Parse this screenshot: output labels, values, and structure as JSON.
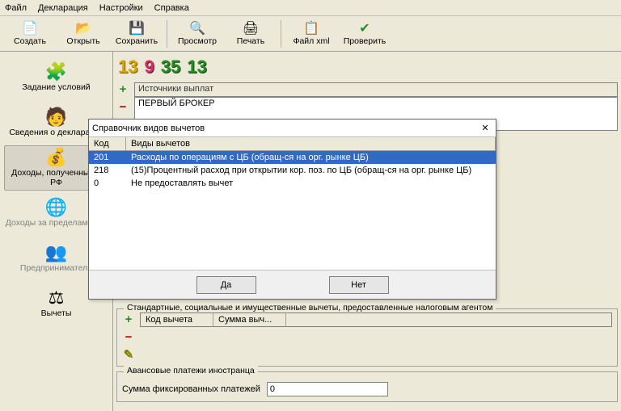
{
  "menu": {
    "items": [
      "Файл",
      "Декларация",
      "Настройки",
      "Справка"
    ]
  },
  "toolbar": {
    "buttons": [
      {
        "label": "Создать",
        "icon": "📄"
      },
      {
        "label": "Открыть",
        "icon": "📂"
      },
      {
        "label": "Сохранить",
        "icon": "💾"
      },
      {
        "label": "Просмотр",
        "icon": "🔍"
      },
      {
        "label": "Печать",
        "icon": "🖨"
      },
      {
        "label": "Файл xml",
        "icon": "📋"
      },
      {
        "label": "Проверить",
        "icon": "✔"
      }
    ]
  },
  "sidebar": {
    "items": [
      {
        "label": "Задание условий",
        "icon": "🧩"
      },
      {
        "label": "Сведения о декларанте",
        "icon": "🧑"
      },
      {
        "label": "Доходы, полученные в РФ",
        "icon": "💰",
        "selected": true
      },
      {
        "label": "Доходы за пределами РФ",
        "icon": "🌐",
        "dim": true
      },
      {
        "label": "Предприниматели",
        "icon": "👥",
        "dim": true
      },
      {
        "label": "Вычеты",
        "icon": "⚖"
      }
    ]
  },
  "colorbar": [
    {
      "t": "13",
      "c": "#d8a600",
      "s": "#7a6000"
    },
    {
      "t": "9",
      "c": "#d03060",
      "s": "#6a1030"
    },
    {
      "t": "35",
      "c": "#2a8a2a",
      "s": "#114a11"
    },
    {
      "t": "13",
      "c": "#2a8a2a",
      "s": "#114a11"
    }
  ],
  "payers": {
    "section_title": "Источники выплат",
    "items": [
      "ПЕРВЫЙ БРОКЕР"
    ]
  },
  "deductions_section": {
    "title": "Стандартные, социальные и имущественные вычеты, предоставленные налоговым агентом",
    "columns": [
      "Код вычета",
      "Сумма выч..."
    ]
  },
  "advance": {
    "title": "Авансовые платежи иностранца",
    "label": "Сумма фиксированных платежей",
    "value": "0"
  },
  "modal": {
    "title": "Справочник видов вычетов",
    "columns": [
      "Код",
      "Виды вычетов"
    ],
    "rows": [
      {
        "code": "201",
        "name": "Расходы по операциям с ЦБ (обращ-ся на орг. рынке ЦБ)",
        "selected": true
      },
      {
        "code": "218",
        "name": "(15)Процентный расход при открытии кор. поз. по ЦБ (обращ-ся на орг. рынке ЦБ)"
      },
      {
        "code": "0",
        "name": "Не предоставлять вычет"
      }
    ],
    "buttons": {
      "yes": "Да",
      "no": "Нет"
    }
  }
}
